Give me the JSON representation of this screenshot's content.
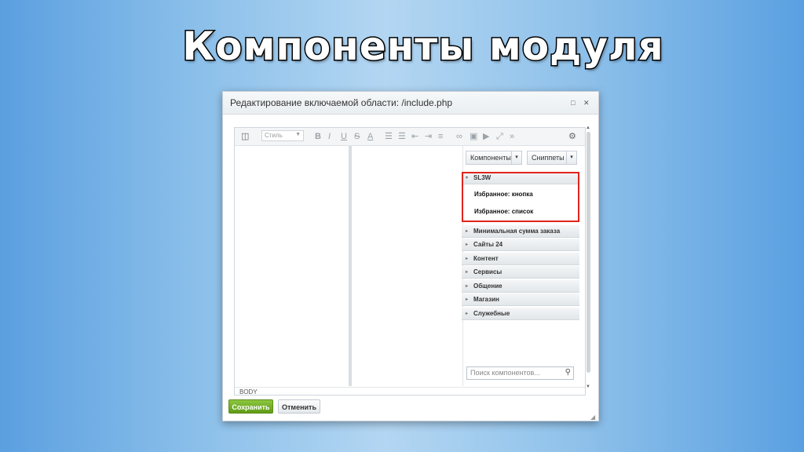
{
  "slide": {
    "title": "Компоненты модуля"
  },
  "dialog": {
    "title": "Редактирование включаемой области: /include.php",
    "minimize_icon": "□",
    "close_icon": "✕"
  },
  "toolbar": {
    "style_select": "Стиль",
    "bold": "B",
    "italic": "I",
    "underline": "U",
    "strike": "S",
    "color": "A"
  },
  "editor": {
    "status_tag": "BODY"
  },
  "sidebar": {
    "components_button": "Компоненты",
    "snippets_button": "Сниппеты",
    "groups": [
      {
        "label": "SL3W",
        "expanded": true,
        "items": [
          "Избранное: кнопка",
          "Избранное: список"
        ]
      },
      {
        "label": "Минимальная сумма заказа"
      },
      {
        "label": "Сайты 24"
      },
      {
        "label": "Контент"
      },
      {
        "label": "Сервисы"
      },
      {
        "label": "Общение"
      },
      {
        "label": "Магазин"
      },
      {
        "label": "Служебные"
      }
    ],
    "search_placeholder": "Поиск компонентов..."
  },
  "footer": {
    "save": "Сохранить",
    "cancel": "Отменить"
  },
  "colors": {
    "save_green": "#6aa81e",
    "highlight_red": "#e0241c"
  }
}
